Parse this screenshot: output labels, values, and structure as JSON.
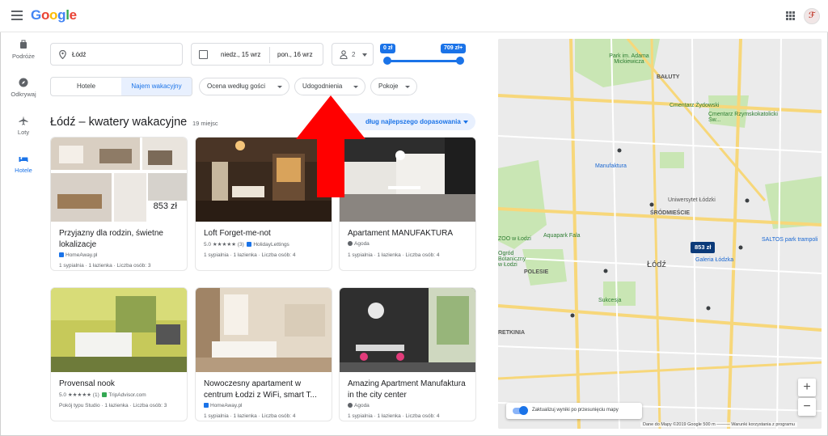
{
  "header": {
    "logo": [
      "G",
      "o",
      "o",
      "g",
      "l",
      "e"
    ],
    "avatar_initial": "ℱ"
  },
  "rail": [
    {
      "label": "Podróże",
      "icon": "suitcase-icon"
    },
    {
      "label": "Odkrywaj",
      "icon": "compass-icon"
    },
    {
      "label": "Loty",
      "icon": "plane-icon"
    },
    {
      "label": "Hotele",
      "icon": "bed-icon"
    }
  ],
  "search": {
    "location": "Łódź",
    "checkin": "niedz., 15 wrz",
    "checkout": "pon., 16 wrz",
    "guests": "2"
  },
  "price_filter": {
    "min_label": "0 zł",
    "max_label": "709 zł+",
    "selected_range_fraction": [
      0,
      1
    ]
  },
  "filters": {
    "segment": [
      "Hotele",
      "Najem wakacyjny"
    ],
    "active_segment": 1,
    "chips": [
      "Ocena według gości",
      "Udogodnienia",
      "Pokoje"
    ]
  },
  "results": {
    "heading": "Łódź – kwatery wakacyjne",
    "count": "19 miejsc",
    "sort": "dług najlepszego dopasowania"
  },
  "cards": [
    {
      "title": "Przyjazny dla rodzin, świetne lokalizacje",
      "rating": "",
      "source": "HomeAway.pl",
      "details": "1 sypialnia · 1 łazienka · Liczba osób: 3",
      "price": "853 zł"
    },
    {
      "title": "Loft Forget-me-not",
      "rating": "5.0 ★★★★★ (3)",
      "source": "HolidayLettings",
      "details": "1 sypialnia · 1 łazienka · Liczba osób: 4",
      "price": ""
    },
    {
      "title": "Apartament MANUFAKTURA",
      "rating": "",
      "source": "Agoda",
      "details": "1 sypialnia · 1 łazienka · Liczba osób: 4",
      "price": ""
    },
    {
      "title": "Provensal nook",
      "rating": "5.0 ★★★★★ (1)",
      "source": "TripAdvisor.com",
      "details": "Pokój typu Studio · 1 łazienka · Liczba osób: 3",
      "price": ""
    },
    {
      "title": "Nowoczesny apartament w centrum Łodzi z WiFi, smart T...",
      "rating": "",
      "source": "HomeAway.pl",
      "details": "1 sypialnia · 1 łazienka · Liczba osób: 4",
      "price": ""
    },
    {
      "title": "Amazing Apartment Manufaktura in the city center",
      "rating": "",
      "source": "Agoda",
      "details": "1 sypialnia · 1 łazienka · Liczba osób: 4",
      "price": ""
    }
  ],
  "map": {
    "city_label": "Łódź",
    "labels": [
      "BAŁUTY",
      "Park im. Adama Mickiewicza",
      "Cmentarz Żydowski",
      "Cmentarz Rzymskokatolicki Św...",
      "Manufaktura",
      "Uniwersytet Łódzki",
      "ŚRÓDMIEŚCIE",
      "Aquapark Fala",
      "ZOO w Łodzi",
      "Ogród Botaniczny w Łodzi",
      "SALTOS park trampoli",
      "Galeria Łódzka",
      "POLESIE",
      "Sukcesja",
      "RETKINIA"
    ],
    "price_pin": "853 zł",
    "toggle_label": "Zaktualizuj wyniki po przesunięciu mapy",
    "attribution": "Dane do Mapy ©2019 Google   500 m ———   Warunki korzystania z programu",
    "zoom_in": "+",
    "zoom_out": "−"
  },
  "annotation": {
    "arrow_color": "#ff0000"
  },
  "colors": {
    "accent": "#1a73e8",
    "map_pin": "#0b3a79"
  }
}
